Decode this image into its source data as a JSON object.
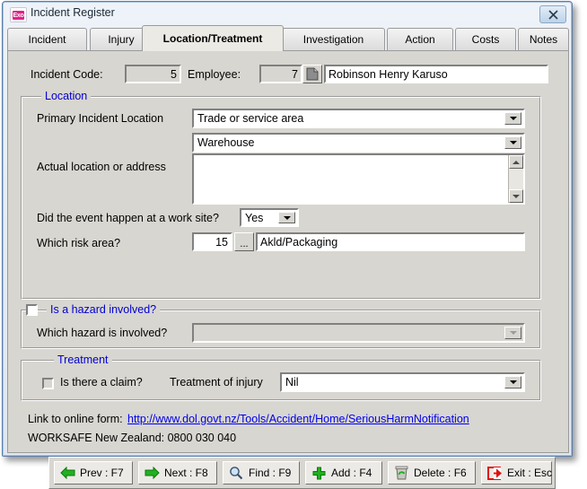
{
  "window": {
    "title": "Incident Register",
    "app_icon": "exo-logo-icon",
    "app_icon_text": "Exo",
    "close_label": "✕"
  },
  "tabs": [
    {
      "label": "Incident",
      "active": false
    },
    {
      "label": "Injury",
      "active": false
    },
    {
      "label": "Location/Treatment",
      "active": true
    },
    {
      "label": "Investigation",
      "active": false
    },
    {
      "label": "Action",
      "active": false
    },
    {
      "label": "Costs",
      "active": false
    },
    {
      "label": "Notes",
      "active": false
    }
  ],
  "header": {
    "incident_code_label": "Incident Code:",
    "incident_code_value": "5",
    "employee_label": "Employee:",
    "employee_code_value": "7",
    "employee_lookup_icon": "document-lookup-icon",
    "employee_name_value": "Robinson Henry Karuso"
  },
  "location_group": {
    "title": "Location",
    "primary_location_label": "Primary Incident Location",
    "primary_location_value": "Trade or service area",
    "secondary_location_value": "Warehouse",
    "actual_address_label": "Actual location or address",
    "actual_address_value": "",
    "work_site_label": "Did the event happen at a work site?",
    "work_site_value": "Yes",
    "risk_area_label": "Which risk area?",
    "risk_area_code": "15",
    "risk_area_browse_label": "...",
    "risk_area_name": "Akld/Packaging"
  },
  "hazard_group": {
    "title": "Is a hazard involved?",
    "checked": false,
    "which_hazard_label": "Which hazard is involved?",
    "which_hazard_value": ""
  },
  "treatment_group": {
    "title": "Treatment",
    "claim_label": "Is there a claim?",
    "claim_checked": false,
    "treatment_label": "Treatment of injury",
    "treatment_value": "Nil"
  },
  "footer": {
    "link_prefix": "Link to online form:",
    "link_url": "http://www.dol.govt.nz/Tools/Accident/Home/SeriousHarmNotification",
    "phone_line": "WORKSAFE New Zealand: 0800 030 040"
  },
  "toolbar": [
    {
      "label": "Prev : F7",
      "icon": "arrow-left-icon"
    },
    {
      "label": "Next : F8",
      "icon": "arrow-right-icon"
    },
    {
      "label": "Find : F9",
      "icon": "magnifier-icon"
    },
    {
      "label": "Add : F4",
      "icon": "plus-icon"
    },
    {
      "label": "Delete : F6",
      "icon": "trash-recycle-icon"
    },
    {
      "label": "Exit : Esc",
      "icon": "exit-door-icon"
    }
  ],
  "colors": {
    "group_title": "#0000d0",
    "link": "#0000ee",
    "face": "#d8d6d0",
    "accent_green": "#15a015",
    "accent_red": "#e01010"
  }
}
